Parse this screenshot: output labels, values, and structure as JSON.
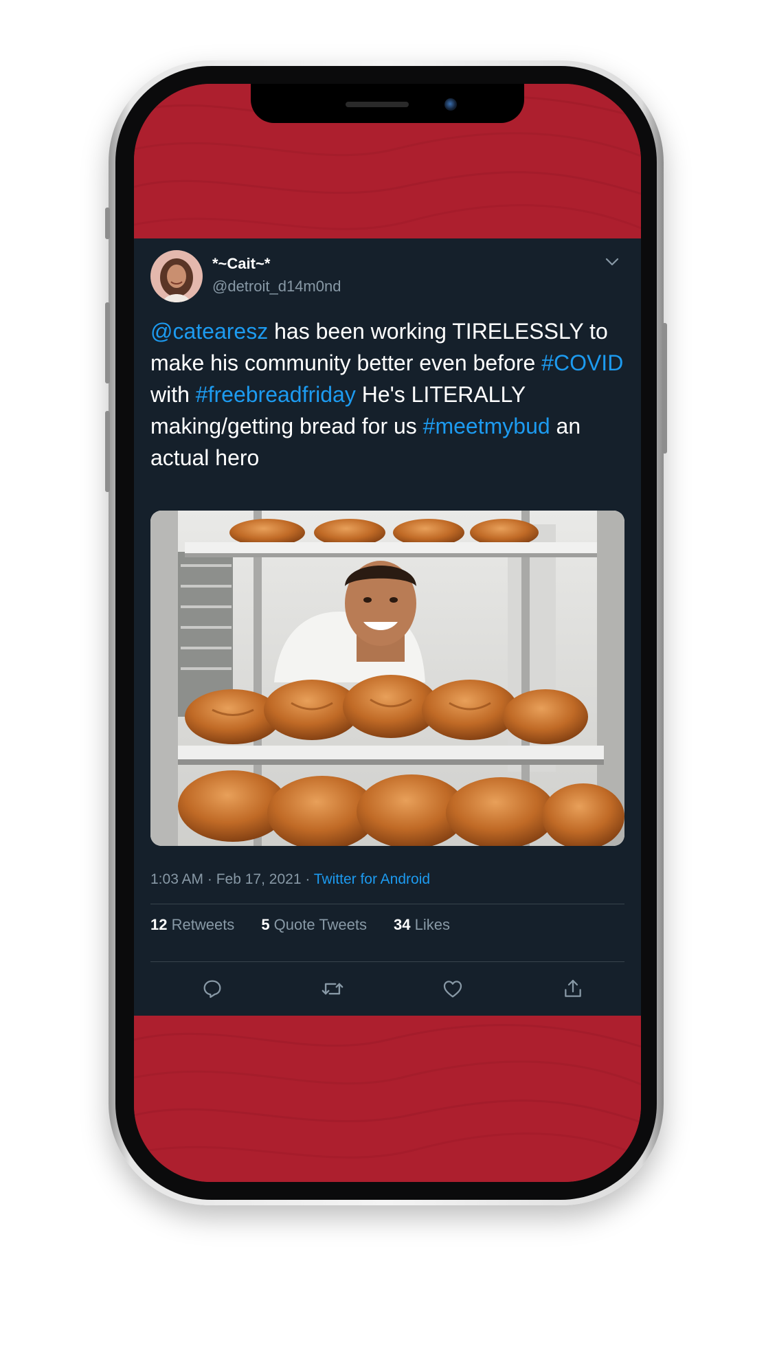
{
  "tweet": {
    "display_name": "*~Cait~*",
    "handle": "@detroit_d14m0nd",
    "text": {
      "mention": "@catearesz",
      "t1": " has been working TIRELESSLY to make his community better even before ",
      "hashtag_covid": "#COVID",
      "t2": " with ",
      "hashtag_freebread": "#freebreadfriday",
      "t3": " He's LITERALLY making/getting bread for us ",
      "hashtag_meetmybud": "#meetmybud",
      "t4": " an actual hero"
    },
    "meta": {
      "time": "1:03 AM",
      "sep1": " · ",
      "date": "Feb 17, 2021",
      "sep2": " · ",
      "source": "Twitter for Android"
    },
    "stats": {
      "retweets_count": "12",
      "retweets_label": " Retweets",
      "quotes_count": "5",
      "quotes_label": " Quote Tweets",
      "likes_count": "34",
      "likes_label": " Likes"
    },
    "actions": [
      "reply-icon",
      "retweet-icon",
      "like-icon",
      "share-icon"
    ]
  },
  "colors": {
    "background_red": "#ad1f2e",
    "tweet_bg": "#15202b",
    "link_blue": "#1d9bf0",
    "secondary_text": "#8899a6"
  }
}
